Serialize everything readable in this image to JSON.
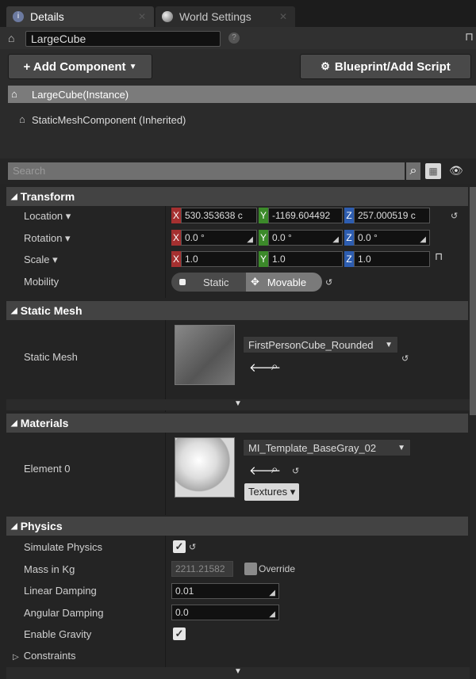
{
  "tabs": [
    {
      "label": "Details"
    },
    {
      "label": "World Settings"
    }
  ],
  "actor_name": "LargeCube",
  "add_component_label": "+ Add Component",
  "blueprint_label": "Blueprint/Add Script",
  "tree": {
    "root": "LargeCube(Instance)",
    "child": "StaticMeshComponent (Inherited)"
  },
  "search_placeholder": "Search",
  "transform": {
    "title": "Transform",
    "location_label": "Location",
    "location": {
      "x": "530.353638 c",
      "y": "-1169.604492",
      "z": "257.000519 c"
    },
    "rotation_label": "Rotation",
    "rotation": {
      "x": "0.0 °",
      "y": "0.0 °",
      "z": "0.0 °"
    },
    "scale_label": "Scale",
    "scale": {
      "x": "1.0",
      "y": "1.0",
      "z": "1.0"
    },
    "mobility_label": "Mobility",
    "mobility_static": "Static",
    "mobility_movable": "Movable"
  },
  "static_mesh": {
    "title": "Static Mesh",
    "label": "Static Mesh",
    "value": "FirstPersonCube_Rounded"
  },
  "materials": {
    "title": "Materials",
    "label": "Element 0",
    "value": "MI_Template_BaseGray_02",
    "textures_label": "Textures"
  },
  "physics": {
    "title": "Physics",
    "simulate_label": "Simulate Physics",
    "mass_label": "Mass in Kg",
    "mass_value": "2211.21582",
    "override_label": "Override",
    "linear_label": "Linear Damping",
    "linear_value": "0.01",
    "angular_label": "Angular Damping",
    "angular_value": "0.0",
    "gravity_label": "Enable Gravity",
    "constraints_label": "Constraints"
  },
  "colors": {
    "axis_x": "#a53030",
    "axis_y": "#3c8a2a",
    "axis_z": "#2d5db0",
    "highlight": "#7b7b7b"
  },
  "icons": [
    "details-icon",
    "world-icon",
    "actor-icon",
    "help-icon",
    "lock-icon",
    "blueprint-icon",
    "search-icon",
    "grid-icon",
    "eye-icon",
    "reset-icon",
    "arrow-icon",
    "browse-icon",
    "chevron-down-icon",
    "check-icon"
  ]
}
